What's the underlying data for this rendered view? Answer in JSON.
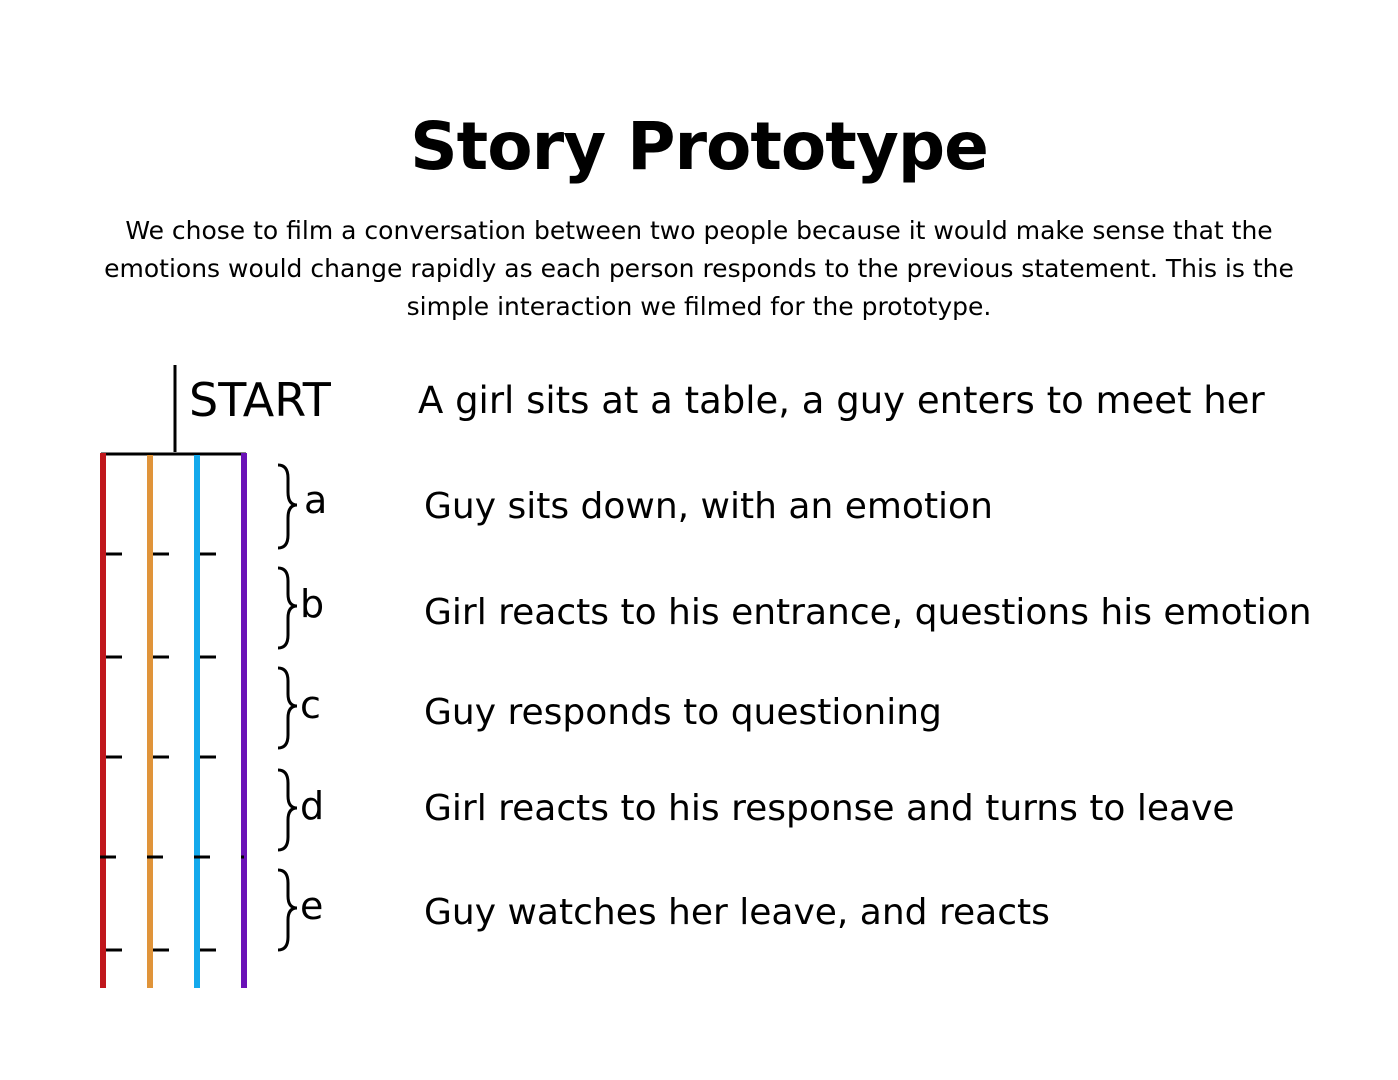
{
  "title": "Story Prototype",
  "intro": "We chose to film a conversation between two people because it would make sense that the emotions would change rapidly as each person responds to the previous statement. This is the simple interaction we filmed for the prototype.",
  "start": {
    "label": "START",
    "text": "A girl sits at a table, a guy enters to meet her"
  },
  "timeline_colors": [
    "#c0171c",
    "#e0943a",
    "#14a9ec",
    "#6a11b7"
  ],
  "segments": [
    {
      "label": "a",
      "text": "Guy sits down, with an emotion"
    },
    {
      "label": "b",
      "text": "Girl reacts to his entrance, questions his emotion"
    },
    {
      "label": "c",
      "text": "Guy responds to questioning"
    },
    {
      "label": "d",
      "text": "Girl reacts to his response and turns to leave"
    },
    {
      "label": "e",
      "text": "Guy watches her leave, and reacts"
    }
  ]
}
